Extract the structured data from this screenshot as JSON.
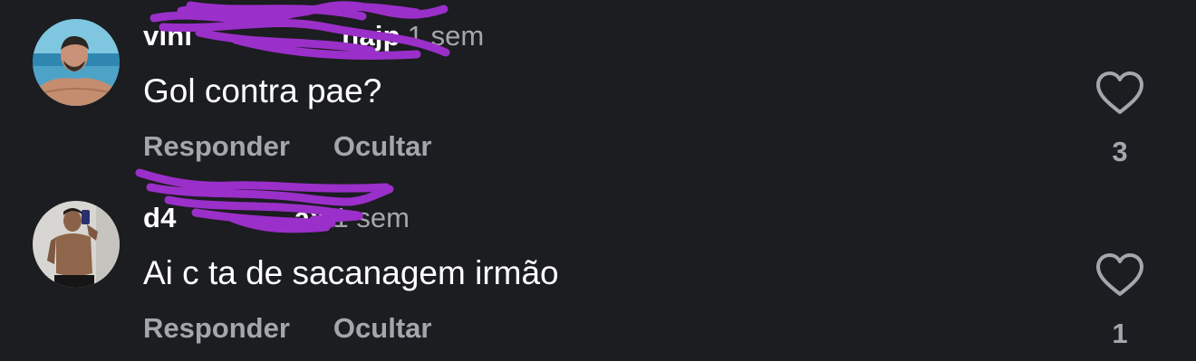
{
  "comments": [
    {
      "username": "vini",
      "username_tail": "najp",
      "time": "1 sem",
      "text": "Gol contra pae?",
      "reply_label": "Responder",
      "hide_label": "Ocultar",
      "likes": "3"
    },
    {
      "username": "d4",
      "username_tail": "ax",
      "time": "1 sem",
      "text": "Ai c ta de sacanagem irmão",
      "reply_label": "Responder",
      "hide_label": "Ocultar",
      "likes": "1"
    }
  ],
  "colors": {
    "background": "#1b1d20",
    "text_primary": "#ffffff",
    "text_secondary": "#a3a7ad",
    "redaction_scribble": "#9b2fc9"
  },
  "icons": {
    "like": "heart-outline-icon"
  }
}
